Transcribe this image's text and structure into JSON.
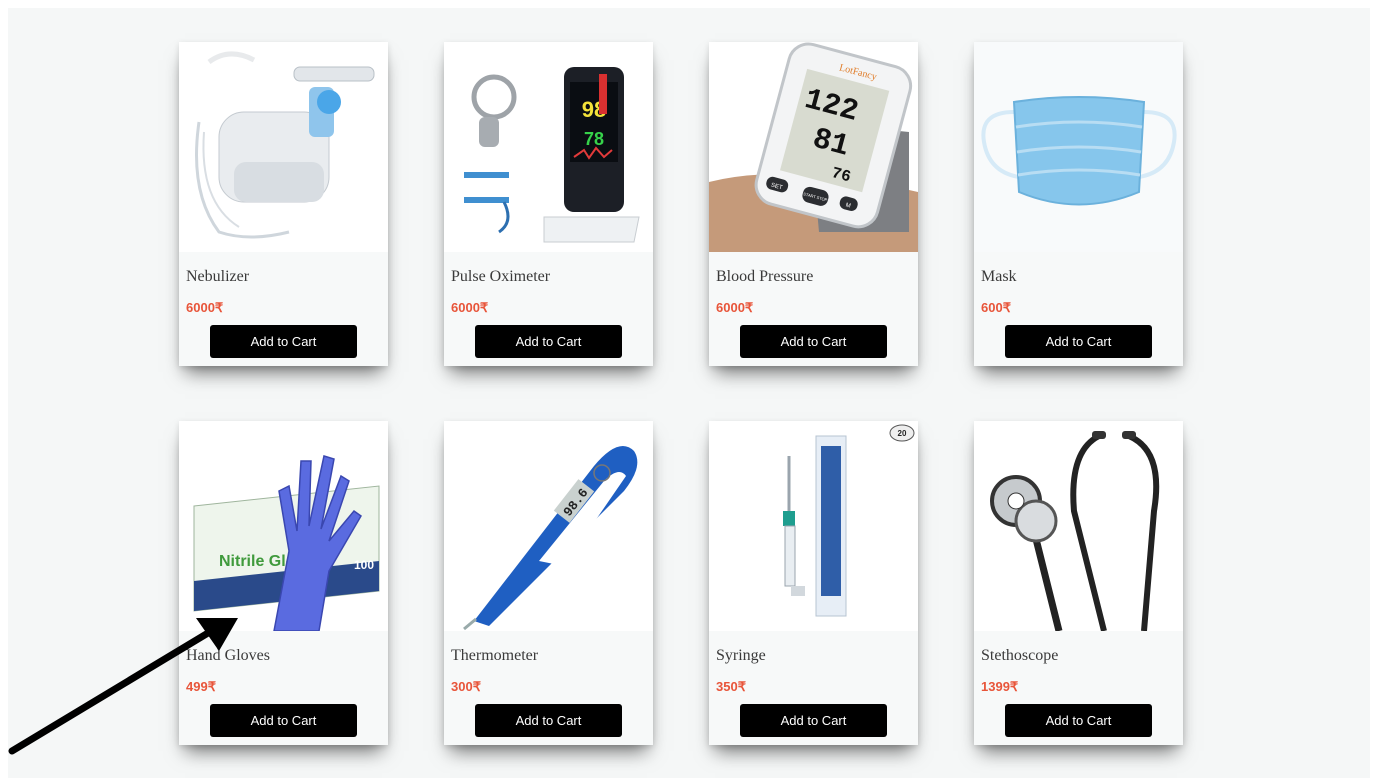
{
  "products": [
    {
      "name": "Nebulizer",
      "price": "6000₹",
      "button": "Add to Cart",
      "image_icon": "nebulizer-image"
    },
    {
      "name": "Pulse Oximeter",
      "price": "6000₹",
      "button": "Add to Cart",
      "image_icon": "pulse-oximeter-image",
      "readout_spo2": "98",
      "readout_pulse": "78"
    },
    {
      "name": "Blood Pressure",
      "price": "6000₹",
      "button": "Add to Cart",
      "image_icon": "blood-pressure-monitor-image",
      "readout_sys": "122",
      "readout_dia": "81",
      "readout_pul": "76",
      "brand": "LotFancy",
      "key_set": "SET",
      "key_start": "START STOP",
      "key_m": "M"
    },
    {
      "name": "Mask",
      "price": "600₹",
      "button": "Add to Cart",
      "image_icon": "face-mask-image"
    },
    {
      "name": "Hand Gloves",
      "price": "499₹",
      "button": "Add to Cart",
      "image_icon": "nitrile-gloves-image",
      "box_text": "Nitrile Glove",
      "box_count": "100"
    },
    {
      "name": "Thermometer",
      "price": "300₹",
      "button": "Add to Cart",
      "image_icon": "thermometer-image",
      "readout": "98.6"
    },
    {
      "name": "Syringe",
      "price": "350₹",
      "button": "Add to Cart",
      "image_icon": "syringe-image",
      "badge": "20"
    },
    {
      "name": "Stethoscope",
      "price": "1399₹",
      "button": "Add to Cart",
      "image_icon": "stethoscope-image"
    }
  ],
  "colors": {
    "price": "#e8553a",
    "button_bg": "#000000",
    "button_text": "#ffffff",
    "panel_bg": "#f5f7f7"
  },
  "overlay": {
    "icon": "black-annotation-arrow-icon"
  }
}
